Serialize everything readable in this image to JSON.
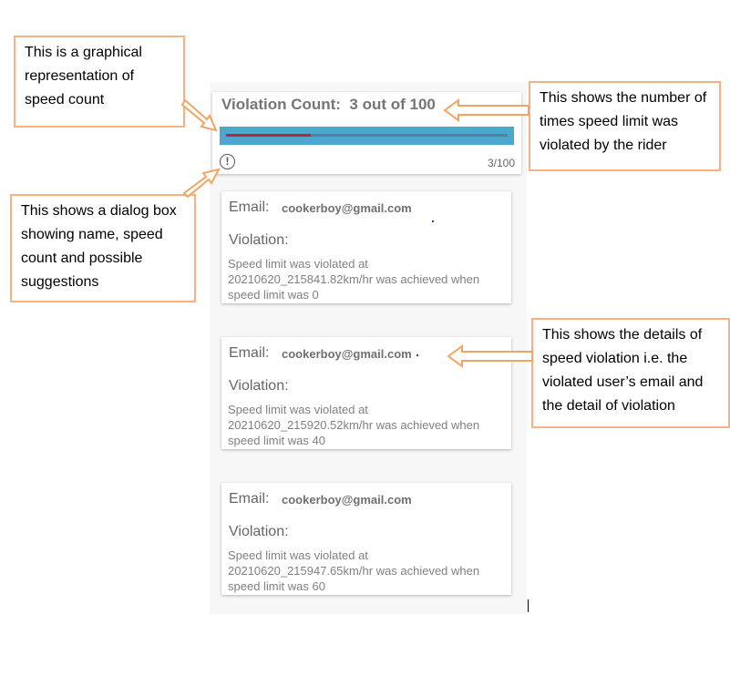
{
  "violation_count": {
    "label": "Violation Count:",
    "value_text": "3 out of 100",
    "count": 3,
    "max": 100,
    "progress_fraction": 0.03,
    "fraction_text": "3/100",
    "info_icon": "alert-circle-icon"
  },
  "violations": [
    {
      "email_label": "Email:",
      "email": "cookerboy@gmail.com",
      "violation_label": "Violation:",
      "detail": "Speed limit was violated at 20210620_215841.82km/hr was achieved when speed limit was 0"
    },
    {
      "email_label": "Email:",
      "email": "cookerboy@gmail.com",
      "violation_label": "Violation:",
      "detail": "Speed limit was violated at 20210620_215920.52km/hr was achieved when speed limit was 40"
    },
    {
      "email_label": "Email:",
      "email": "cookerboy@gmail.com",
      "violation_label": "Violation:",
      "detail": "Speed limit was violated at 20210620_215947.65km/hr was achieved when speed limit was 60"
    }
  ],
  "annotations": {
    "graphical": "This is a graphical representation of speed count",
    "count": "This shows the number of times speed limit was violated by the rider",
    "dialog": "This shows a dialog box showing name, speed count and possible suggestions",
    "details": "This shows the details of speed violation i.e. the violated user’s email and the detail of violation"
  },
  "colors": {
    "progress_bg": "#4aa8d0",
    "progress_fill": "#c0203a",
    "annotation_border": "#f4b183"
  }
}
